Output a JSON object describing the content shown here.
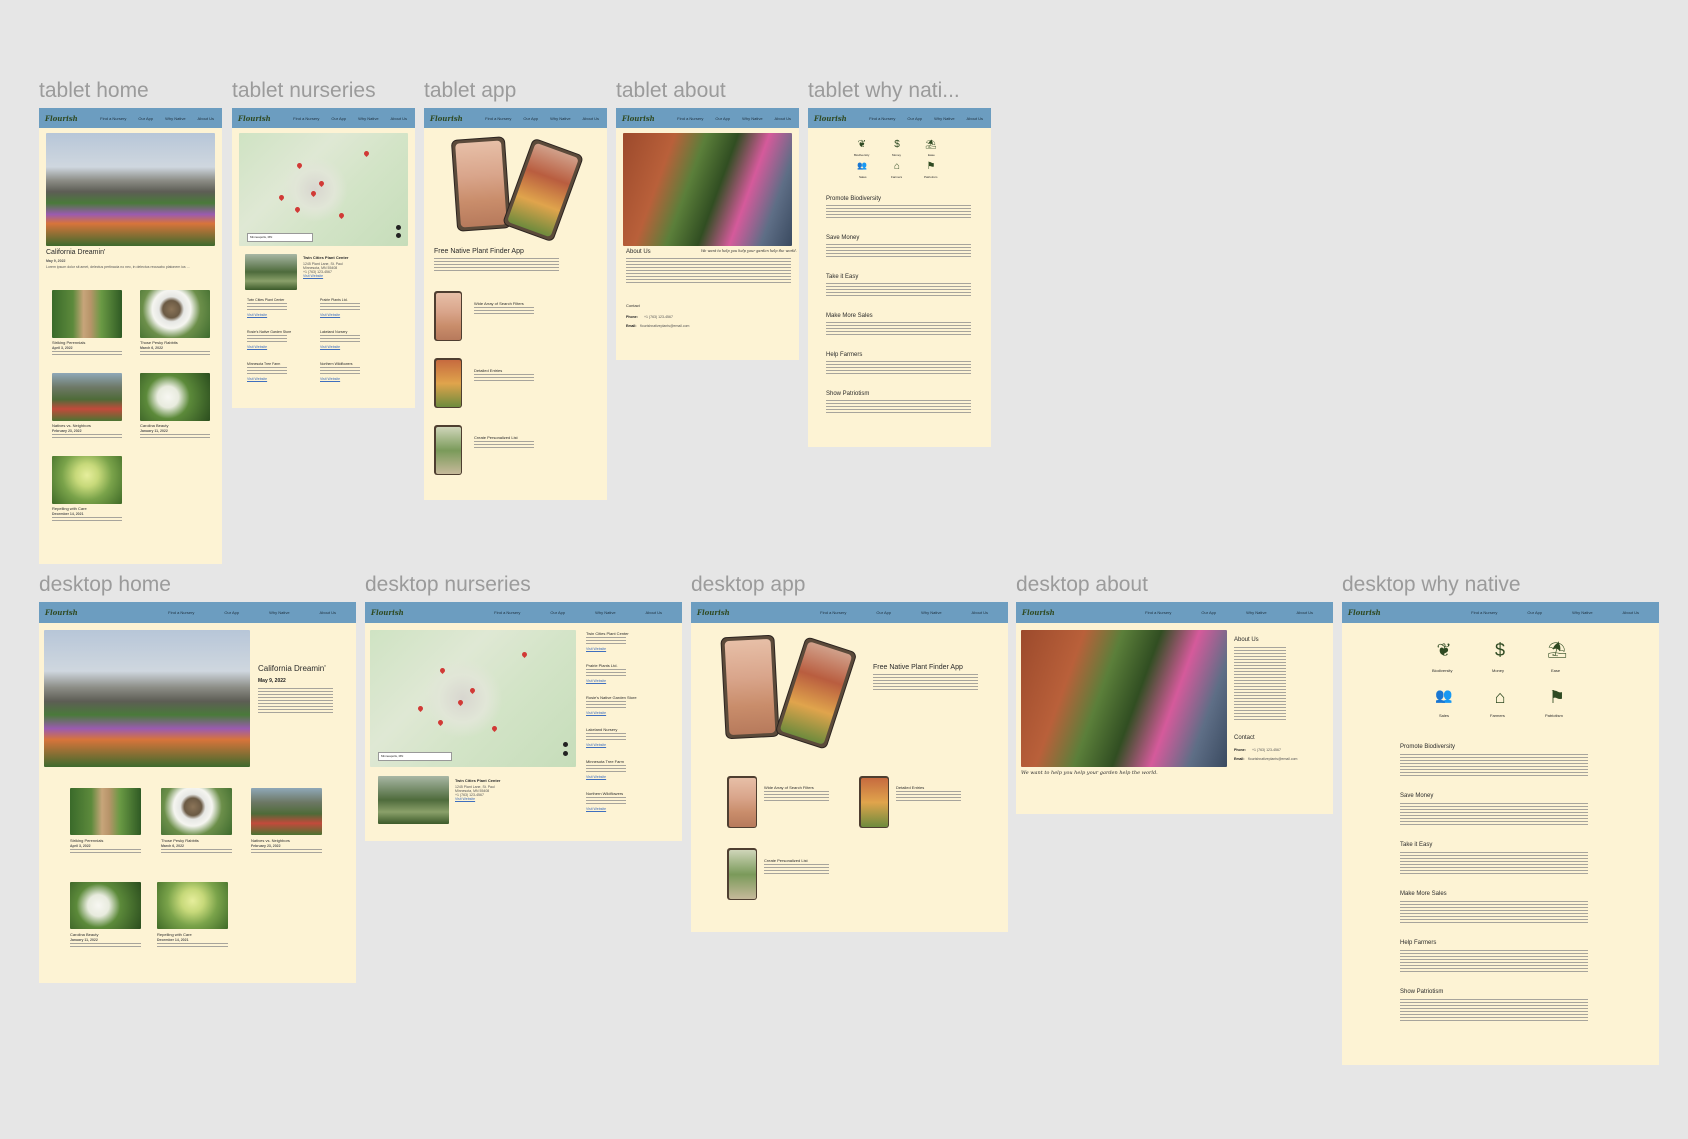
{
  "frames": {
    "tablet_home": {
      "title": "tablet home"
    },
    "tablet_nurseries": {
      "title": "tablet nurseries"
    },
    "tablet_app": {
      "title": "tablet app"
    },
    "tablet_about": {
      "title": "tablet about"
    },
    "tablet_why": {
      "title": "tablet why nati..."
    },
    "desktop_home": {
      "title": "desktop home"
    },
    "desktop_nurseries": {
      "title": "desktop nurseries"
    },
    "desktop_app": {
      "title": "desktop app"
    },
    "desktop_about": {
      "title": "desktop about"
    },
    "desktop_why": {
      "title": "desktop why native"
    }
  },
  "nav": {
    "logo": "Flourish",
    "links": [
      "Find a Nursery",
      "Our App",
      "Why Native",
      "About Us"
    ]
  },
  "home": {
    "featured_title": "California Dreamin'",
    "featured_date": "May 9, 2022",
    "featured_excerpt": "Lorem ipsum dolor sit amet, delectus pertinacia no nec, in delectus recusabo platonem ius ...",
    "posts": [
      {
        "title": "Striking Perennials",
        "date": "April 3, 2022"
      },
      {
        "title": "Those Pesky Rabbits",
        "date": "March 6, 2022"
      },
      {
        "title": "Natives vs. Neighbors",
        "date": "February 23, 2022"
      },
      {
        "title": "Carolina Beauty",
        "date": "January 11, 2022"
      },
      {
        "title": "Repelling with Care",
        "date": "December 14, 2021"
      }
    ]
  },
  "nurseries": {
    "search_value": "Minneapolis, MN",
    "featured": {
      "name": "Twin Cities Plant Center",
      "address": "1245 Plant Lane, St. Paul",
      "city": "Minnesota, MN 55408",
      "phone": "+1 (763) 123-4567",
      "link": "Visit Website"
    },
    "list": [
      {
        "name": "Twin Cities Plant Center",
        "link": "Visit Website"
      },
      {
        "name": "Prairie Plants Ltd.",
        "link": "Visit Website"
      },
      {
        "name": "Rosie's Native Garden Store",
        "link": "Visit Website"
      },
      {
        "name": "Lakeland Nursery",
        "link": "Visit Website"
      },
      {
        "name": "Minnesota Tree Farm",
        "link": "Visit Website"
      },
      {
        "name": "Northern Wildflowers",
        "link": "Visit Website"
      }
    ]
  },
  "app": {
    "title": "Free Native Plant Finder App",
    "features": [
      "Wide Array of Search Filters",
      "Detailed Entries",
      "Create Personalized List"
    ]
  },
  "about": {
    "tagline": "We want to help you help your garden help the world.",
    "title": "About Us",
    "contact_title": "Contact",
    "phone_label": "Phone:",
    "phone": "+1 (763) 123-4567",
    "email_label": "Email:",
    "email": "flourishnativeplants@email.com"
  },
  "why": {
    "icons": [
      {
        "label": "Biodiversity",
        "icon": "butterfly-icon",
        "glyph": "❦"
      },
      {
        "label": "Money",
        "icon": "dollar-icon",
        "glyph": "$"
      },
      {
        "label": "Ease",
        "icon": "hammock-icon",
        "glyph": "⛱"
      },
      {
        "label": "Sales",
        "icon": "people-icon",
        "glyph": "👥"
      },
      {
        "label": "Farmers",
        "icon": "barn-icon",
        "glyph": "⌂"
      },
      {
        "label": "Patriotism",
        "icon": "flag-icon",
        "glyph": "⚑"
      }
    ],
    "sections": [
      "Promote Biodiversity",
      "Save Money",
      "Take it Easy",
      "Make More Sales",
      "Help Farmers",
      "Show Patriotism"
    ]
  }
}
